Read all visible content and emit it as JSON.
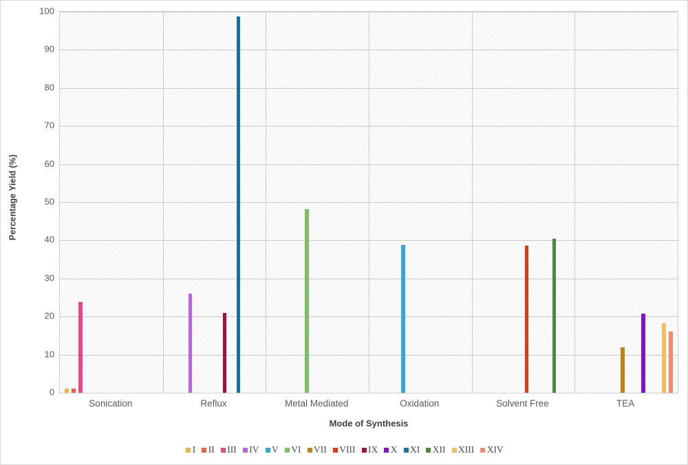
{
  "chart_data": {
    "type": "bar",
    "title": "",
    "xlabel": "Mode of Synthesis",
    "ylabel": "Percentage Yield (%)",
    "ylim": [
      0,
      100
    ],
    "ytick_step": 10,
    "yticks": [
      "0",
      "10",
      "20",
      "30",
      "40",
      "50",
      "60",
      "70",
      "80",
      "90",
      "100"
    ],
    "grid": true,
    "legend_position": "bottom",
    "categories": [
      "Sonication",
      "Reflux",
      "Metal Mediated",
      "Oxidation",
      "Solvent Free",
      "TEA"
    ],
    "series": [
      {
        "name": "I",
        "color": "#e8b24c",
        "values": [
          1.0,
          0,
          0,
          0,
          0,
          0
        ]
      },
      {
        "name": "II",
        "color": "#e8633c",
        "values": [
          1.0,
          0,
          0,
          0,
          0,
          0
        ]
      },
      {
        "name": "III",
        "color": "#e8458a",
        "values": [
          23.8,
          0,
          0,
          0,
          0,
          0
        ]
      },
      {
        "name": "IV",
        "color": "#bb63e0",
        "values": [
          0,
          26.0,
          0,
          0,
          0,
          0
        ]
      },
      {
        "name": "V",
        "color": "#38a5e0",
        "values": [
          0,
          0,
          0,
          38.9,
          0,
          0
        ]
      },
      {
        "name": "VI",
        "color": "#7cc062",
        "values": [
          0,
          0,
          48.2,
          0,
          0,
          0
        ]
      },
      {
        "name": "VII",
        "color": "#bb8417",
        "values": [
          0,
          0,
          0,
          0,
          0,
          12.0
        ]
      },
      {
        "name": "VIII",
        "color": "#de3a13",
        "values": [
          0,
          0,
          0,
          0,
          38.6,
          0
        ]
      },
      {
        "name": "IX",
        "color": "#a31236",
        "values": [
          0,
          21.0,
          0,
          0,
          0,
          0
        ]
      },
      {
        "name": "X",
        "color": "#8214c8",
        "values": [
          0,
          0,
          0,
          0,
          0,
          20.8
        ]
      },
      {
        "name": "XI",
        "color": "#14739e",
        "values": [
          0,
          98.8,
          0,
          0,
          0,
          0
        ]
      },
      {
        "name": "XII",
        "color": "#4a8a3c",
        "values": [
          0,
          0,
          0,
          0,
          40.5,
          0
        ]
      },
      {
        "name": "XIII",
        "color": "#f0be62",
        "values": [
          0,
          0,
          0,
          0,
          0,
          18.2
        ]
      },
      {
        "name": "XIV",
        "color": "#f58a70",
        "values": [
          0,
          0,
          0,
          0,
          0,
          16.0
        ]
      }
    ]
  }
}
